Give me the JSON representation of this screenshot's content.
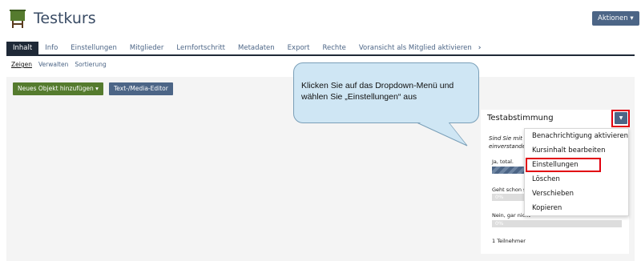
{
  "header": {
    "title": "Testkurs",
    "actions_label": "Aktionen ▾"
  },
  "tabs": [
    {
      "label": "Inhalt",
      "active": true
    },
    {
      "label": "Info"
    },
    {
      "label": "Einstellungen"
    },
    {
      "label": "Mitglieder"
    },
    {
      "label": "Lernfortschritt"
    },
    {
      "label": "Metadaten"
    },
    {
      "label": "Export"
    },
    {
      "label": "Rechte"
    },
    {
      "label": "Voransicht als Mitglied aktivieren"
    }
  ],
  "subtabs": [
    {
      "label": "Zeigen",
      "active": true
    },
    {
      "label": "Verwalten"
    },
    {
      "label": "Sortierung"
    }
  ],
  "toolbar": {
    "new_object_label": "Neues Objekt hinzufügen ▾",
    "editor_label": "Text-/Media-Editor"
  },
  "callout": {
    "text": "Klicken Sie auf das Dropdown-Menü und wählen Sie „Einstellungen“ aus"
  },
  "poll": {
    "title": "Testabstimmung",
    "question_line1": "Sind Sie mit d",
    "question_line2": "einverstande",
    "answers": [
      {
        "label": "Ja, total.",
        "percent": 25,
        "pct_label": ""
      },
      {
        "label": "Geht schon s",
        "percent": 0,
        "pct_label": "0%"
      },
      {
        "label": "Nein, gar nicht",
        "percent": 0,
        "pct_label": "0%"
      }
    ],
    "participants": "1 Teilnehmer"
  },
  "dropdown_menu": {
    "items": [
      "Benachrichtigung aktivieren",
      "Kursinhalt bearbeiten",
      "Einstellungen",
      "Löschen",
      "Verschieben",
      "Kopieren"
    ]
  },
  "colors": {
    "primary": "#4c6586",
    "success": "#557b2e",
    "highlight": "#e1000f",
    "callout": "#cfe6f4",
    "icon": "#557b2e"
  },
  "icons": {
    "course": "course-board-icon",
    "dropdown": "caret-down-icon",
    "tab_more": "chevron-right-icon"
  }
}
